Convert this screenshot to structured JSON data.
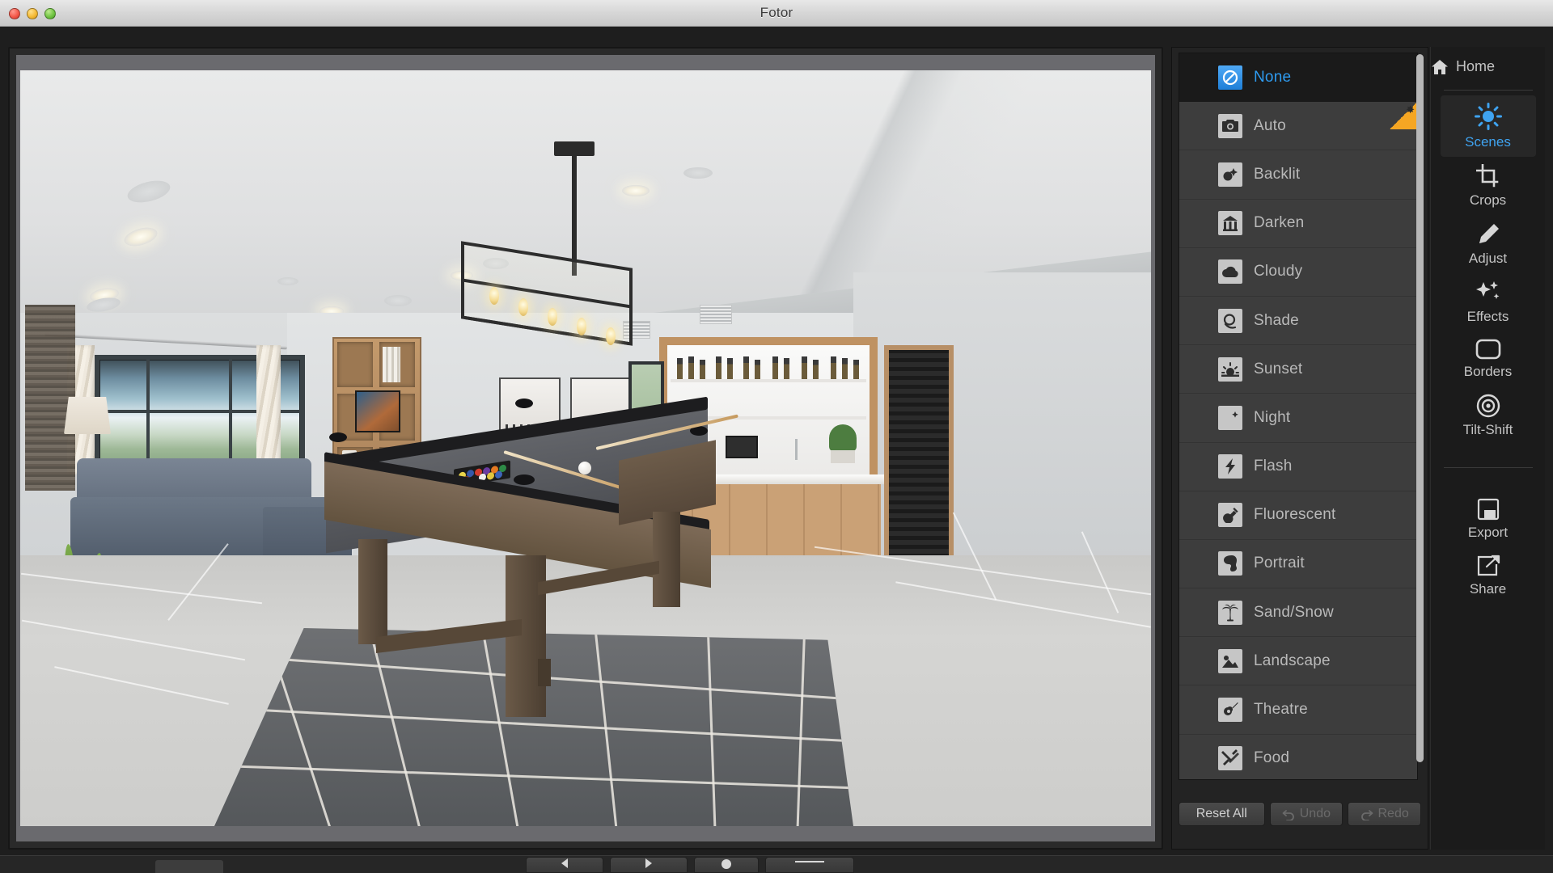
{
  "window": {
    "title": "Fotor",
    "traffic_lights": [
      "close",
      "minimize",
      "maximize"
    ]
  },
  "scenes_panel": {
    "items": [
      {
        "label": "None",
        "icon": "no-entry-icon",
        "selected": true,
        "badge": null
      },
      {
        "label": "Auto",
        "icon": "camera-icon",
        "selected": false,
        "badge": "new-star"
      },
      {
        "label": "Backlit",
        "icon": "backlit-icon",
        "selected": false,
        "badge": null
      },
      {
        "label": "Darken",
        "icon": "darken-icon",
        "selected": false,
        "badge": null
      },
      {
        "label": "Cloudy",
        "icon": "cloud-icon",
        "selected": false,
        "badge": null
      },
      {
        "label": "Shade",
        "icon": "shade-icon",
        "selected": false,
        "badge": null
      },
      {
        "label": "Sunset",
        "icon": "sunset-icon",
        "selected": false,
        "badge": null
      },
      {
        "label": "Night",
        "icon": "moon-icon",
        "selected": false,
        "badge": null
      },
      {
        "label": "Flash",
        "icon": "lightning-icon",
        "selected": false,
        "badge": null
      },
      {
        "label": "Fluorescent",
        "icon": "lightbulb-icon",
        "selected": false,
        "badge": null
      },
      {
        "label": "Portrait",
        "icon": "portrait-icon",
        "selected": false,
        "badge": null
      },
      {
        "label": "Sand/Snow",
        "icon": "palm-tree-icon",
        "selected": false,
        "badge": null
      },
      {
        "label": "Landscape",
        "icon": "landscape-icon",
        "selected": false,
        "badge": null
      },
      {
        "label": "Theatre",
        "icon": "guitar-icon",
        "selected": false,
        "badge": null
      },
      {
        "label": "Food",
        "icon": "cutlery-icon",
        "selected": false,
        "badge": null
      }
    ],
    "actions": {
      "reset_all": "Reset All",
      "undo": "Undo",
      "redo": "Redo",
      "undo_enabled": false,
      "redo_enabled": false
    },
    "badge_symbol": "✸"
  },
  "tool_rail": {
    "home": {
      "label": "Home",
      "icon": "home-icon"
    },
    "tools": [
      {
        "label": "Scenes",
        "icon": "sun-icon",
        "active": true
      },
      {
        "label": "Crops",
        "icon": "crop-icon",
        "active": false
      },
      {
        "label": "Adjust",
        "icon": "pencil-icon",
        "active": false
      },
      {
        "label": "Effects",
        "icon": "sparkles-icon",
        "active": false
      },
      {
        "label": "Borders",
        "icon": "rounded-rect-icon",
        "active": false
      },
      {
        "label": "Tilt-Shift",
        "icon": "target-icon",
        "active": false
      }
    ],
    "output": [
      {
        "label": "Export",
        "icon": "floppy-disk-icon"
      },
      {
        "label": "Share",
        "icon": "share-arrow-icon"
      }
    ]
  },
  "canvas": {
    "photo_description": "Interior photo of a modern game room with a wooden pool table on a gray patterned rug, linear cage chandelier, built-in bookshelves, a wet bar with bottles and a wine fridge, gray sectional sofa and large window",
    "zoom_fit": "fit"
  },
  "colors": {
    "accent_blue": "#2e9bf0",
    "badge_orange": "#f5a623",
    "panel_bg": "#3d3d3d",
    "panel_selected": "#1a1a1a",
    "rail_bg": "#1b1b1b",
    "titlebar_text": "#3b3b3b"
  }
}
